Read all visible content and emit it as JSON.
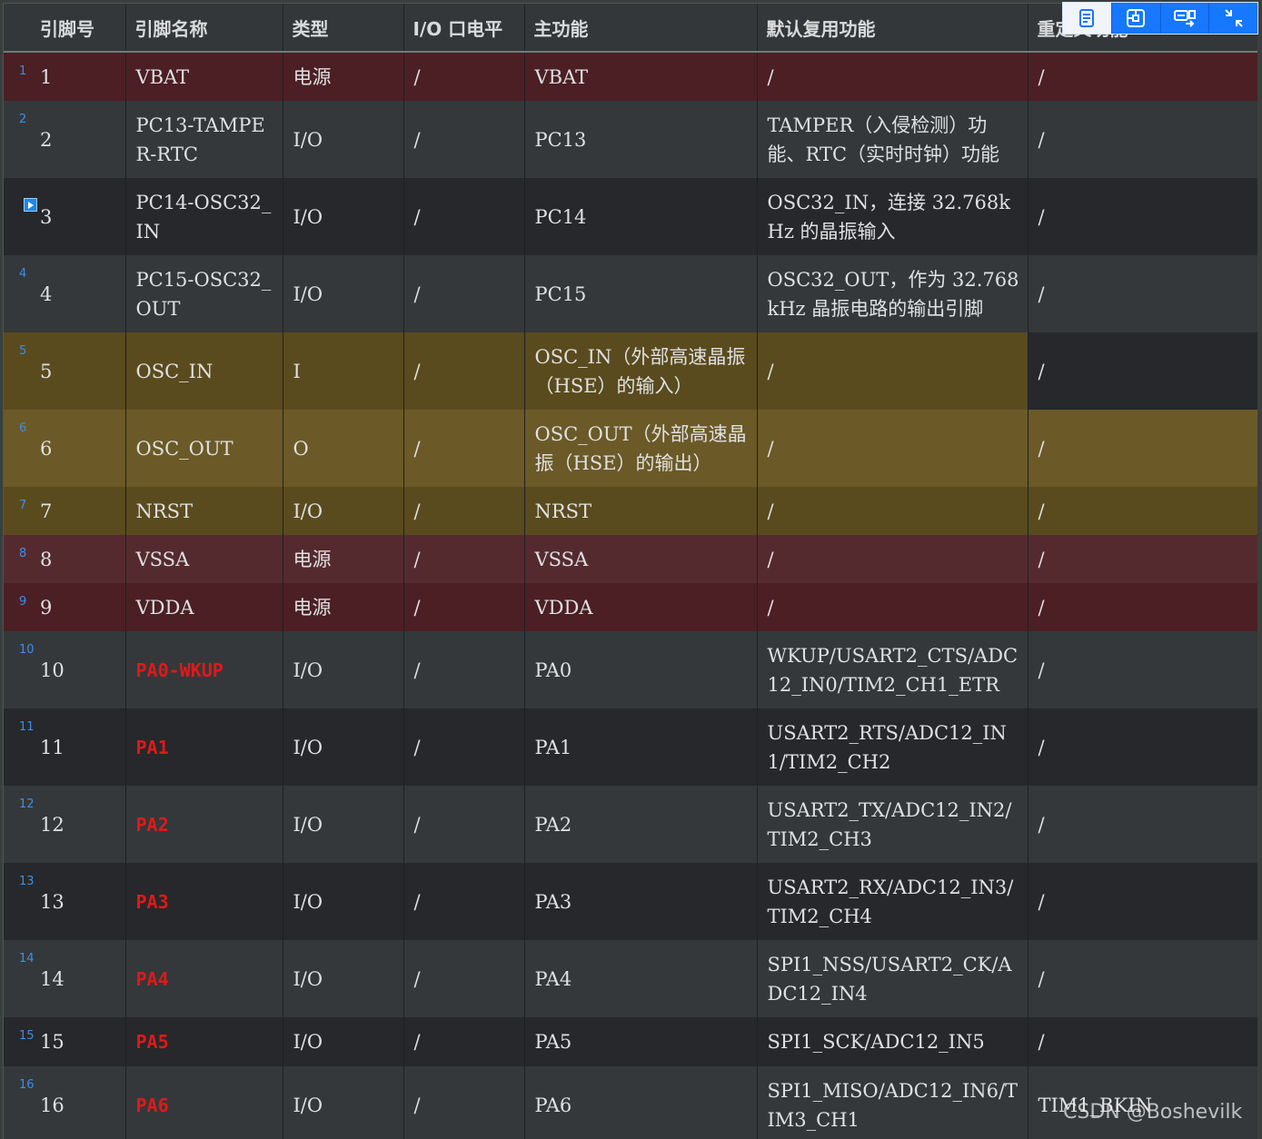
{
  "table": {
    "headers": [
      "引脚号",
      "引脚名称",
      "类型",
      "I/O 口电平",
      "主功能",
      "默认复用功能",
      "重定义功能"
    ],
    "rows": [
      {
        "ln": "1",
        "pin": "1",
        "name": "VBAT",
        "type": "电源",
        "level": "/",
        "main": "VBAT",
        "alt": "/",
        "remap": "/"
      },
      {
        "ln": "2",
        "pin": "2",
        "name": "PC13-TAMPER-RTC",
        "type": "I/O",
        "level": "/",
        "main": "PC13",
        "alt": "TAMPER（入侵检测）功能、RTC（实时时钟）功能",
        "remap": "/"
      },
      {
        "ln": "",
        "pin": "3",
        "name": "PC14-OSC32_IN",
        "type": "I/O",
        "level": "/",
        "main": "PC14",
        "alt": "OSC32_IN，连接 32.768kHz 的晶振输入",
        "remap": "/"
      },
      {
        "ln": "4",
        "pin": "4",
        "name": "PC15-OSC32_OUT",
        "type": "I/O",
        "level": "/",
        "main": "PC15",
        "alt": "OSC32_OUT，作为 32.768kHz 晶振电路的输出引脚",
        "remap": "/"
      },
      {
        "ln": "5",
        "pin": "5",
        "name": "OSC_IN",
        "type": "I",
        "level": "/",
        "main": "OSC_IN（外部高速晶振（HSE）的输入）",
        "alt": "/",
        "remap": "/"
      },
      {
        "ln": "6",
        "pin": "6",
        "name": "OSC_OUT",
        "type": "O",
        "level": "/",
        "main": "OSC_OUT（外部高速晶振（HSE）的输出）",
        "alt": "/",
        "remap": "/"
      },
      {
        "ln": "7",
        "pin": "7",
        "name": "NRST",
        "type": "I/O",
        "level": "/",
        "main": "NRST",
        "alt": "/",
        "remap": "/"
      },
      {
        "ln": "8",
        "pin": "8",
        "name": "VSSA",
        "type": "电源",
        "level": "/",
        "main": "VSSA",
        "alt": "/",
        "remap": "/"
      },
      {
        "ln": "9",
        "pin": "9",
        "name": "VDDA",
        "type": "电源",
        "level": "/",
        "main": "VDDA",
        "alt": "/",
        "remap": "/"
      },
      {
        "ln": "10",
        "pin": "10",
        "name": "PA0-WKUP",
        "type": "I/O",
        "level": "/",
        "main": "PA0",
        "alt": "WKUP/USART2_CTS/ADC12_IN0/TIM2_CH1_ETR",
        "remap": "/"
      },
      {
        "ln": "11",
        "pin": "11",
        "name": "PA1",
        "type": "I/O",
        "level": "/",
        "main": "PA1",
        "alt": "USART2_RTS/ADC12_IN1/TIM2_CH2",
        "remap": "/"
      },
      {
        "ln": "12",
        "pin": "12",
        "name": "PA2",
        "type": "I/O",
        "level": "/",
        "main": "PA2",
        "alt": "USART2_TX/ADC12_IN2/TIM2_CH3",
        "remap": "/"
      },
      {
        "ln": "13",
        "pin": "13",
        "name": "PA3",
        "type": "I/O",
        "level": "/",
        "main": "PA3",
        "alt": "USART2_RX/ADC12_IN3/TIM2_CH4",
        "remap": "/"
      },
      {
        "ln": "14",
        "pin": "14",
        "name": "PA4",
        "type": "I/O",
        "level": "/",
        "main": "PA4",
        "alt": "SPI1_NSS/USART2_CK/ADC12_IN4",
        "remap": "/"
      },
      {
        "ln": "15",
        "pin": "15",
        "name": "PA5",
        "type": "I/O",
        "level": "/",
        "main": "PA5",
        "alt": "SPI1_SCK/ADC12_IN5",
        "remap": "/"
      },
      {
        "ln": "16",
        "pin": "16",
        "name": "PA6",
        "type": "I/O",
        "level": "/",
        "main": "PA6",
        "alt": "SPI1_MISO/ADC12_IN6/TIM3_CH1",
        "remap": "TIM1_BKIN"
      }
    ]
  },
  "toolbar": {
    "icons": [
      "document-icon",
      "layout-icon",
      "translate-icon",
      "exit-fullscreen-icon"
    ]
  },
  "watermark": "CSDN @Boshevilk",
  "colors": {
    "power_row": "#4b1f24",
    "osc_row": "#5a4b1e",
    "red_pin": "#e01919",
    "toolbar_blue": "#1677ff",
    "line_number_blue": "#3a8fe8"
  }
}
